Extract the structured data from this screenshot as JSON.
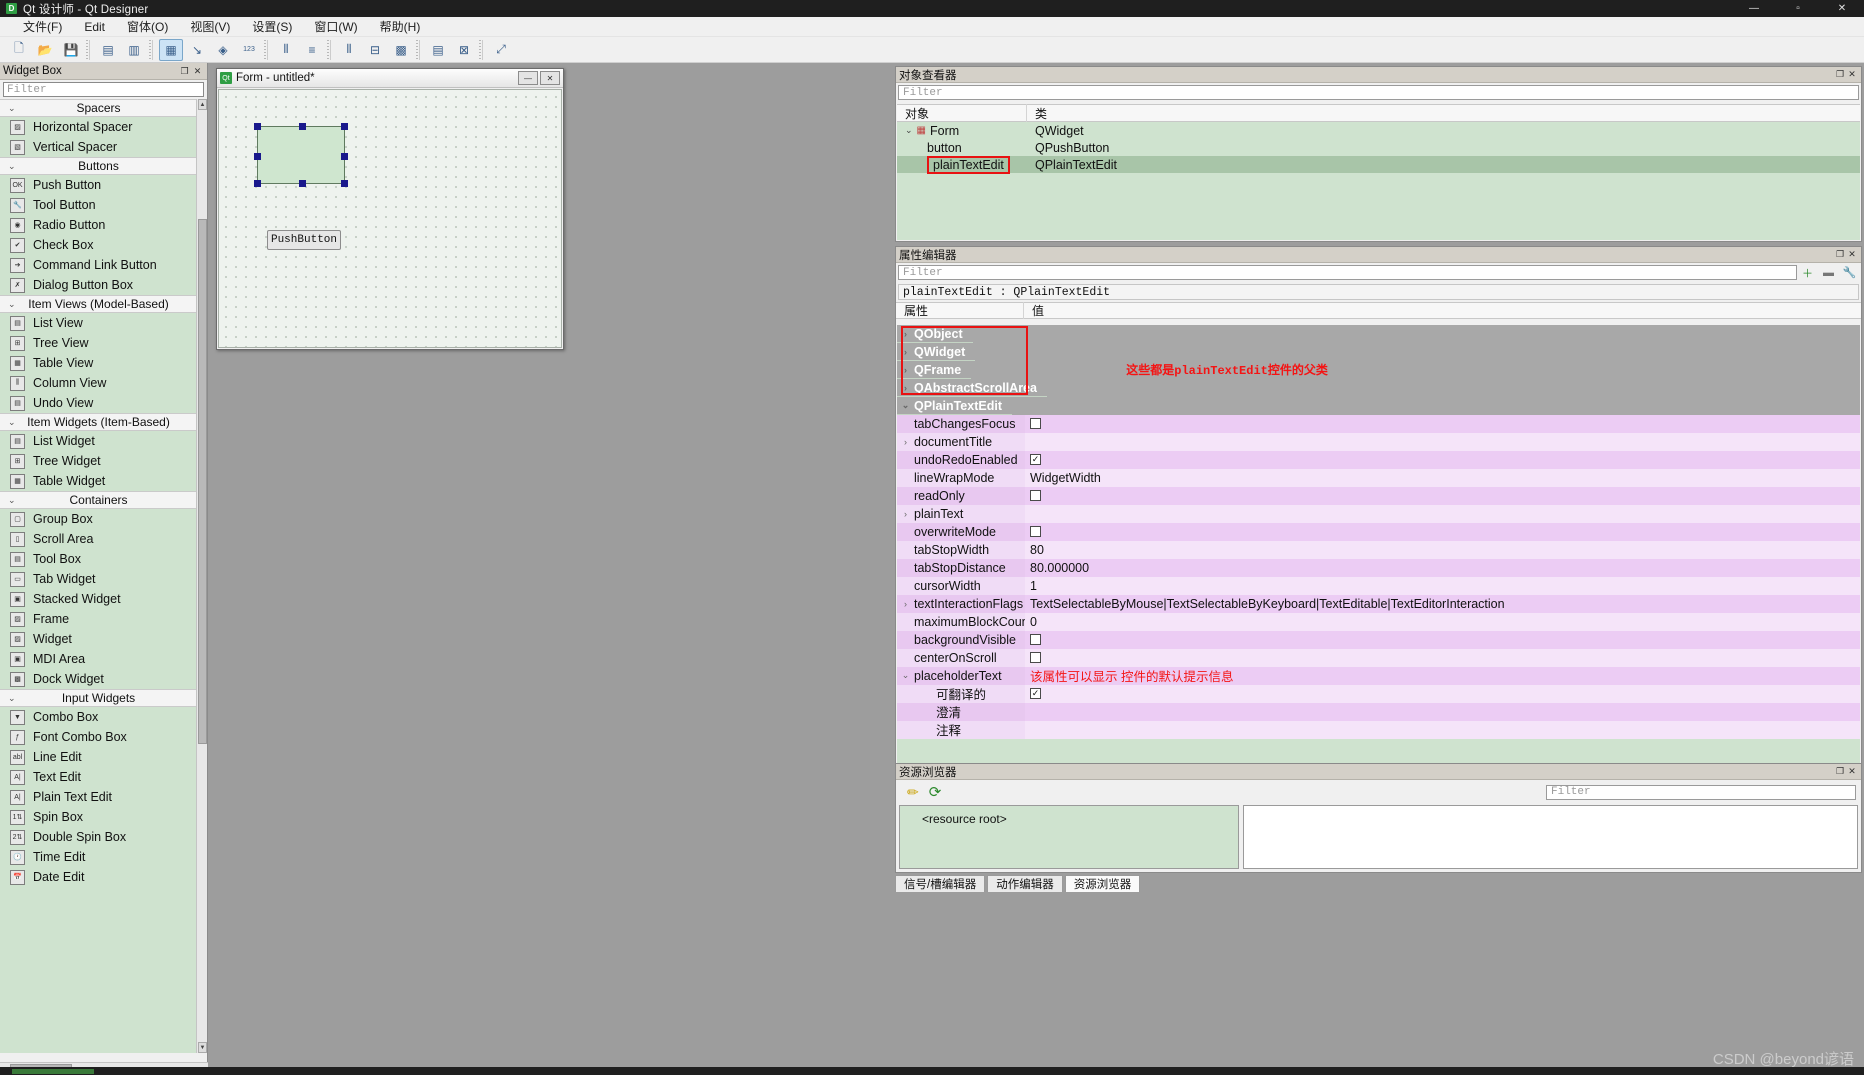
{
  "window": {
    "title": "Qt 设计师 - Qt Designer",
    "logo": "D",
    "minimize": "—",
    "maximize": "▫",
    "close": "✕"
  },
  "menubar": {
    "items": [
      {
        "label": "文件(F)",
        "name": "menu-file"
      },
      {
        "label": "Edit",
        "name": "menu-edit"
      },
      {
        "label": "窗体(O)",
        "name": "menu-form"
      },
      {
        "label": "视图(V)",
        "name": "menu-view"
      },
      {
        "label": "设置(S)",
        "name": "menu-settings"
      },
      {
        "label": "窗口(W)",
        "name": "menu-window"
      },
      {
        "label": "帮助(H)",
        "name": "menu-help"
      }
    ]
  },
  "toolbar": {
    "buttons": [
      {
        "name": "new-form-icon",
        "glyph": "🗋",
        "active": false
      },
      {
        "name": "open-form-icon",
        "glyph": "📂",
        "active": false
      },
      {
        "name": "save-form-icon",
        "glyph": "💾",
        "active": false
      },
      {
        "name": "undo-icon",
        "glyph": "▤",
        "active": false
      },
      {
        "name": "redo-icon",
        "glyph": "▥",
        "active": false
      },
      {
        "name": "edit-widgets-icon",
        "glyph": "▦",
        "active": true
      },
      {
        "name": "edit-signals-slots-icon",
        "glyph": "↘",
        "active": false
      },
      {
        "name": "edit-buddies-icon",
        "glyph": "◈",
        "active": false
      },
      {
        "name": "edit-tab-order-icon",
        "glyph": "123",
        "active": false
      },
      {
        "name": "layout-horizontally-icon",
        "glyph": "⦀",
        "active": false
      },
      {
        "name": "layout-vertically-icon",
        "glyph": "≡",
        "active": false
      },
      {
        "name": "layout-splitter-h-icon",
        "glyph": "⫴",
        "active": false
      },
      {
        "name": "layout-splitter-v-icon",
        "glyph": "⊟",
        "active": false
      },
      {
        "name": "layout-grid-icon",
        "glyph": "▩",
        "active": false
      },
      {
        "name": "layout-form-icon",
        "glyph": "▤",
        "active": false
      },
      {
        "name": "break-layout-icon",
        "glyph": "⊠",
        "active": false
      },
      {
        "name": "adjust-size-icon",
        "glyph": "⤢",
        "active": false
      }
    ]
  },
  "widget_box": {
    "title": "Widget Box",
    "filter_placeholder": "Filter",
    "float_btn": "❐",
    "close_btn": "✕",
    "groups": [
      {
        "name": "Spacers",
        "items": [
          {
            "label": "Horizontal Spacer",
            "icon": "horizontal-spacer-icon",
            "glyph": "▨"
          },
          {
            "label": "Vertical Spacer",
            "icon": "vertical-spacer-icon",
            "glyph": "▧"
          }
        ]
      },
      {
        "name": "Buttons",
        "items": [
          {
            "label": "Push Button",
            "icon": "push-button-icon",
            "glyph": "OK"
          },
          {
            "label": "Tool Button",
            "icon": "tool-button-icon",
            "glyph": "🔧"
          },
          {
            "label": "Radio Button",
            "icon": "radio-button-icon",
            "glyph": "◉"
          },
          {
            "label": "Check Box",
            "icon": "check-box-icon",
            "glyph": "✔"
          },
          {
            "label": "Command Link Button",
            "icon": "command-link-button-icon",
            "glyph": "➔"
          },
          {
            "label": "Dialog Button Box",
            "icon": "dialog-button-box-icon",
            "glyph": "✗"
          }
        ]
      },
      {
        "name": "Item Views (Model-Based)",
        "items": [
          {
            "label": "List View",
            "icon": "list-view-icon",
            "glyph": "▤"
          },
          {
            "label": "Tree View",
            "icon": "tree-view-icon",
            "glyph": "⊞"
          },
          {
            "label": "Table View",
            "icon": "table-view-icon",
            "glyph": "▦"
          },
          {
            "label": "Column View",
            "icon": "column-view-icon",
            "glyph": "⫼"
          },
          {
            "label": "Undo View",
            "icon": "undo-view-icon",
            "glyph": "▤"
          }
        ]
      },
      {
        "name": "Item Widgets (Item-Based)",
        "items": [
          {
            "label": "List Widget",
            "icon": "list-widget-icon",
            "glyph": "▤"
          },
          {
            "label": "Tree Widget",
            "icon": "tree-widget-icon",
            "glyph": "⊞"
          },
          {
            "label": "Table Widget",
            "icon": "table-widget-icon",
            "glyph": "▦"
          }
        ]
      },
      {
        "name": "Containers",
        "items": [
          {
            "label": "Group Box",
            "icon": "group-box-icon",
            "glyph": "▢"
          },
          {
            "label": "Scroll Area",
            "icon": "scroll-area-icon",
            "glyph": "▯"
          },
          {
            "label": "Tool Box",
            "icon": "tool-box-icon",
            "glyph": "▤"
          },
          {
            "label": "Tab Widget",
            "icon": "tab-widget-icon",
            "glyph": "▭"
          },
          {
            "label": "Stacked Widget",
            "icon": "stacked-widget-icon",
            "glyph": "▣"
          },
          {
            "label": "Frame",
            "icon": "frame-icon",
            "glyph": "▨"
          },
          {
            "label": "Widget",
            "icon": "widget-icon",
            "glyph": "▨"
          },
          {
            "label": "MDI Area",
            "icon": "mdi-area-icon",
            "glyph": "▣"
          },
          {
            "label": "Dock Widget",
            "icon": "dock-widget-icon",
            "glyph": "▩"
          }
        ]
      },
      {
        "name": "Input Widgets",
        "items": [
          {
            "label": "Combo Box",
            "icon": "combo-box-icon",
            "glyph": "▼"
          },
          {
            "label": "Font Combo Box",
            "icon": "font-combo-box-icon",
            "glyph": "ƒ"
          },
          {
            "label": "Line Edit",
            "icon": "line-edit-icon",
            "glyph": "abl"
          },
          {
            "label": "Text Edit",
            "icon": "text-edit-icon",
            "glyph": "A|"
          },
          {
            "label": "Plain Text Edit",
            "icon": "plain-text-edit-icon",
            "glyph": "A|"
          },
          {
            "label": "Spin Box",
            "icon": "spin-box-icon",
            "glyph": "1⇅"
          },
          {
            "label": "Double Spin Box",
            "icon": "double-spin-box-icon",
            "glyph": "2⇅"
          },
          {
            "label": "Time Edit",
            "icon": "time-edit-icon",
            "glyph": "🕐"
          },
          {
            "label": "Date Edit",
            "icon": "date-edit-icon",
            "glyph": "📅"
          }
        ]
      }
    ]
  },
  "form_window": {
    "title": "Form - untitled*",
    "icon": "qt-icon",
    "minimize_btn": "—",
    "close_btn": "✕",
    "push_button_text": "PushButton",
    "selected_widget": "plainTextEdit"
  },
  "object_inspector": {
    "title": "对象查看器",
    "float_btn": "❐",
    "close_btn": "✕",
    "filter_placeholder": "Filter",
    "columns": [
      "对象",
      "类"
    ],
    "rows": [
      {
        "object": "Form",
        "class": "QWidget",
        "level": 0,
        "expanded": true,
        "selected": false,
        "highlighted": false
      },
      {
        "object": "button",
        "class": "QPushButton",
        "level": 1,
        "expanded": false,
        "selected": false,
        "highlighted": false
      },
      {
        "object": "plainTextEdit",
        "class": "QPlainTextEdit",
        "level": 1,
        "expanded": false,
        "selected": true,
        "highlighted": true
      }
    ]
  },
  "property_editor": {
    "title": "属性编辑器",
    "float_btn": "❐",
    "close_btn": "✕",
    "filter_placeholder": "Filter",
    "add_btn": "＋",
    "remove_btn": "▬",
    "config_btn": "🔧",
    "object_line": "plainTextEdit : QPlainTextEdit",
    "columns": [
      "属性",
      "值"
    ],
    "annotation_parent_classes": "这些都是plainTextEdit控件的父类",
    "annotation_placeholder": "该属性可以显示 控件的默认提示信息",
    "rows": [
      {
        "name": "QObject",
        "value": "",
        "kind": "group",
        "arrow": "›",
        "indent": 0
      },
      {
        "name": "QWidget",
        "value": "",
        "kind": "group",
        "arrow": "›",
        "indent": 0
      },
      {
        "name": "QFrame",
        "value": "",
        "kind": "group",
        "arrow": "›",
        "indent": 0
      },
      {
        "name": "QAbstractScrollArea",
        "value": "",
        "kind": "group",
        "arrow": "›",
        "indent": 0
      },
      {
        "name": "QPlainTextEdit",
        "value": "",
        "kind": "group",
        "arrow": "⌄",
        "indent": 0
      },
      {
        "name": "tabChangesFocus",
        "value": "",
        "kind": "checkbox",
        "checked": false,
        "arrow": "",
        "indent": 1
      },
      {
        "name": "documentTitle",
        "value": "",
        "kind": "text",
        "arrow": "›",
        "indent": 1
      },
      {
        "name": "undoRedoEnabled",
        "value": "",
        "kind": "checkbox",
        "checked": true,
        "arrow": "",
        "indent": 1
      },
      {
        "name": "lineWrapMode",
        "value": "WidgetWidth",
        "kind": "text",
        "arrow": "",
        "indent": 1
      },
      {
        "name": "readOnly",
        "value": "",
        "kind": "checkbox",
        "checked": false,
        "arrow": "",
        "indent": 1
      },
      {
        "name": "plainText",
        "value": "",
        "kind": "text",
        "arrow": "›",
        "indent": 1
      },
      {
        "name": "overwriteMode",
        "value": "",
        "kind": "checkbox",
        "checked": false,
        "arrow": "",
        "indent": 1
      },
      {
        "name": "tabStopWidth",
        "value": "80",
        "kind": "text",
        "arrow": "",
        "indent": 1
      },
      {
        "name": "tabStopDistance",
        "value": "80.000000",
        "kind": "text",
        "arrow": "",
        "indent": 1
      },
      {
        "name": "cursorWidth",
        "value": "1",
        "kind": "text",
        "arrow": "",
        "indent": 1
      },
      {
        "name": "textInteractionFlags",
        "value": "TextSelectableByMouse|TextSelectableByKeyboard|TextEditable|TextEditorInteraction",
        "kind": "text",
        "arrow": "›",
        "indent": 1
      },
      {
        "name": "maximumBlockCount",
        "value": "0",
        "kind": "text",
        "arrow": "",
        "indent": 1
      },
      {
        "name": "backgroundVisible",
        "value": "",
        "kind": "checkbox",
        "checked": false,
        "arrow": "",
        "indent": 1
      },
      {
        "name": "centerOnScroll",
        "value": "",
        "kind": "checkbox",
        "checked": false,
        "arrow": "",
        "indent": 1
      },
      {
        "name": "placeholderText",
        "value": "",
        "kind": "annotated",
        "arrow": "⌄",
        "indent": 1
      },
      {
        "name": "可翻译的",
        "value": "",
        "kind": "checkbox",
        "checked": true,
        "arrow": "",
        "indent": 2
      },
      {
        "name": "澄清",
        "value": "",
        "kind": "text",
        "arrow": "",
        "indent": 2
      },
      {
        "name": "注释",
        "value": "",
        "kind": "text",
        "arrow": "",
        "indent": 2
      }
    ]
  },
  "resource_browser": {
    "title": "资源浏览器",
    "float_btn": "❐",
    "close_btn": "✕",
    "edit_icon": "✏",
    "reload_icon": "⟳",
    "root_label": "<resource root>",
    "filter_placeholder": "Filter"
  },
  "bottom_tabs": [
    {
      "label": "信号/槽编辑器",
      "active": false
    },
    {
      "label": "动作编辑器",
      "active": false
    },
    {
      "label": "资源浏览器",
      "active": true
    }
  ],
  "watermark": "CSDN @beyond谚语"
}
